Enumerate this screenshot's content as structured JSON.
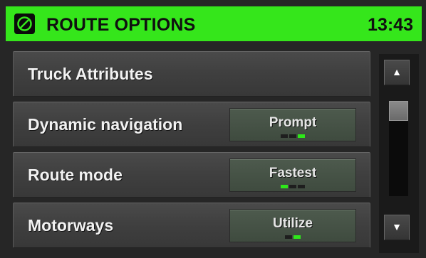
{
  "header": {
    "logo_icon": "compass-icon",
    "title": "ROUTE OPTIONS",
    "clock": "13:43",
    "accent": "#35e61b"
  },
  "menu": {
    "items": [
      {
        "label": "Truck Attributes",
        "value": null
      },
      {
        "label": "Dynamic navigation",
        "value": "Prompt",
        "option_count": 3,
        "selected_index": 2
      },
      {
        "label": "Route mode",
        "value": "Fastest",
        "option_count": 3,
        "selected_index": 0
      },
      {
        "label": "Motorways",
        "value": "Utilize",
        "option_count": 2,
        "selected_index": 1
      }
    ]
  },
  "scrollbar": {
    "up_icon": "arrow-up-icon",
    "down_icon": "arrow-down-icon",
    "position": 0.0
  }
}
